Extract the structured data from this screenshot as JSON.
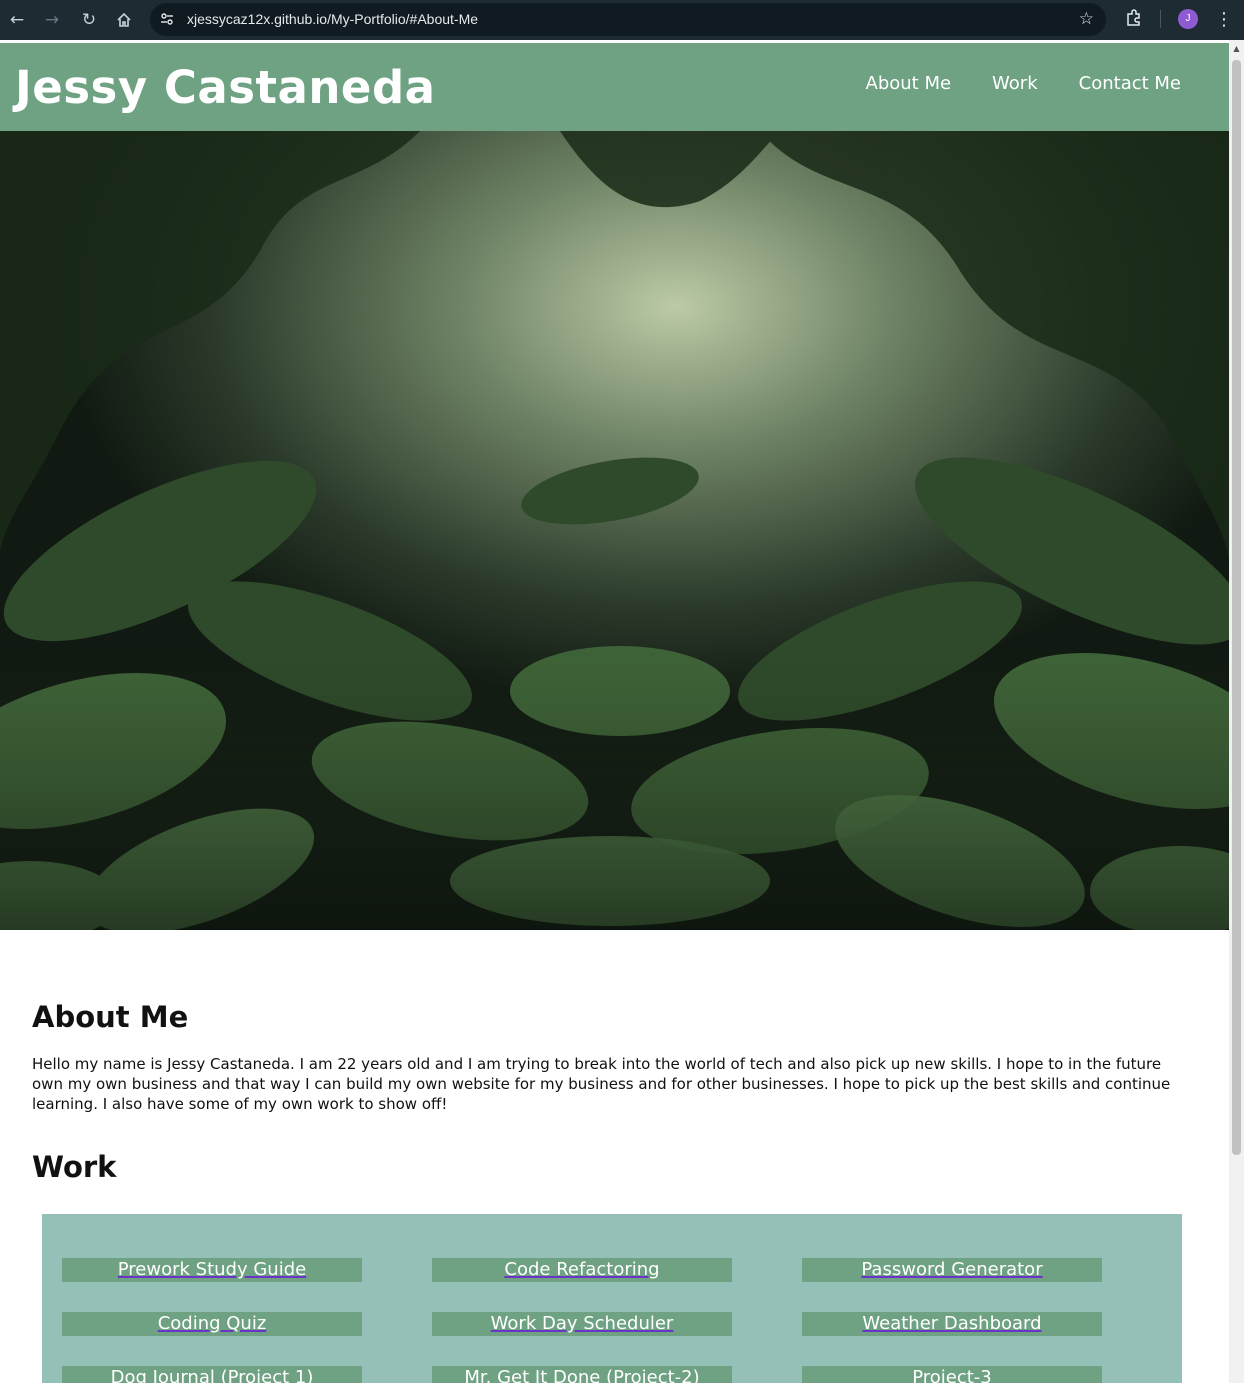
{
  "browser": {
    "url": "xjessycaz12x.github.io/My-Portfolio/#About-Me",
    "profile_initial": "J"
  },
  "header": {
    "title": "Jessy Castaneda",
    "nav": [
      {
        "label": "About Me"
      },
      {
        "label": "Work"
      },
      {
        "label": "Contact Me"
      }
    ]
  },
  "about": {
    "heading": "About Me",
    "text": "Hello my name is Jessy Castaneda. I am 22 years old and I am trying to break into the world of tech and also pick up new skills. I hope to in the future own my own business and that way I can build my own website for my business and for other businesses. I hope to pick up the best skills and continue learning. I also have some of my own work to show off!"
  },
  "work": {
    "heading": "Work",
    "projects": [
      {
        "label": "Prework Study Guide"
      },
      {
        "label": "Code Refactoring"
      },
      {
        "label": "Password Generator"
      },
      {
        "label": "Coding Quiz"
      },
      {
        "label": "Work Day Scheduler"
      },
      {
        "label": "Weather Dashboard"
      },
      {
        "label": "Dog Journal (Project 1)"
      },
      {
        "label": "Mr. Get It Done (Project-2)"
      },
      {
        "label": "Project-3"
      }
    ]
  },
  "colors": {
    "header_bg": "#6fa283",
    "work_panel_bg": "#95c0b8",
    "card_bg": "#6fa283",
    "link_underline": "#6a34c7"
  },
  "icons": {
    "back": "arrow-left-icon",
    "forward": "arrow-right-icon",
    "reload": "reload-icon",
    "home": "home-icon",
    "site_info": "tune-icon",
    "bookmark": "star-icon",
    "extensions": "puzzle-icon",
    "menu": "kebab-menu-icon"
  }
}
